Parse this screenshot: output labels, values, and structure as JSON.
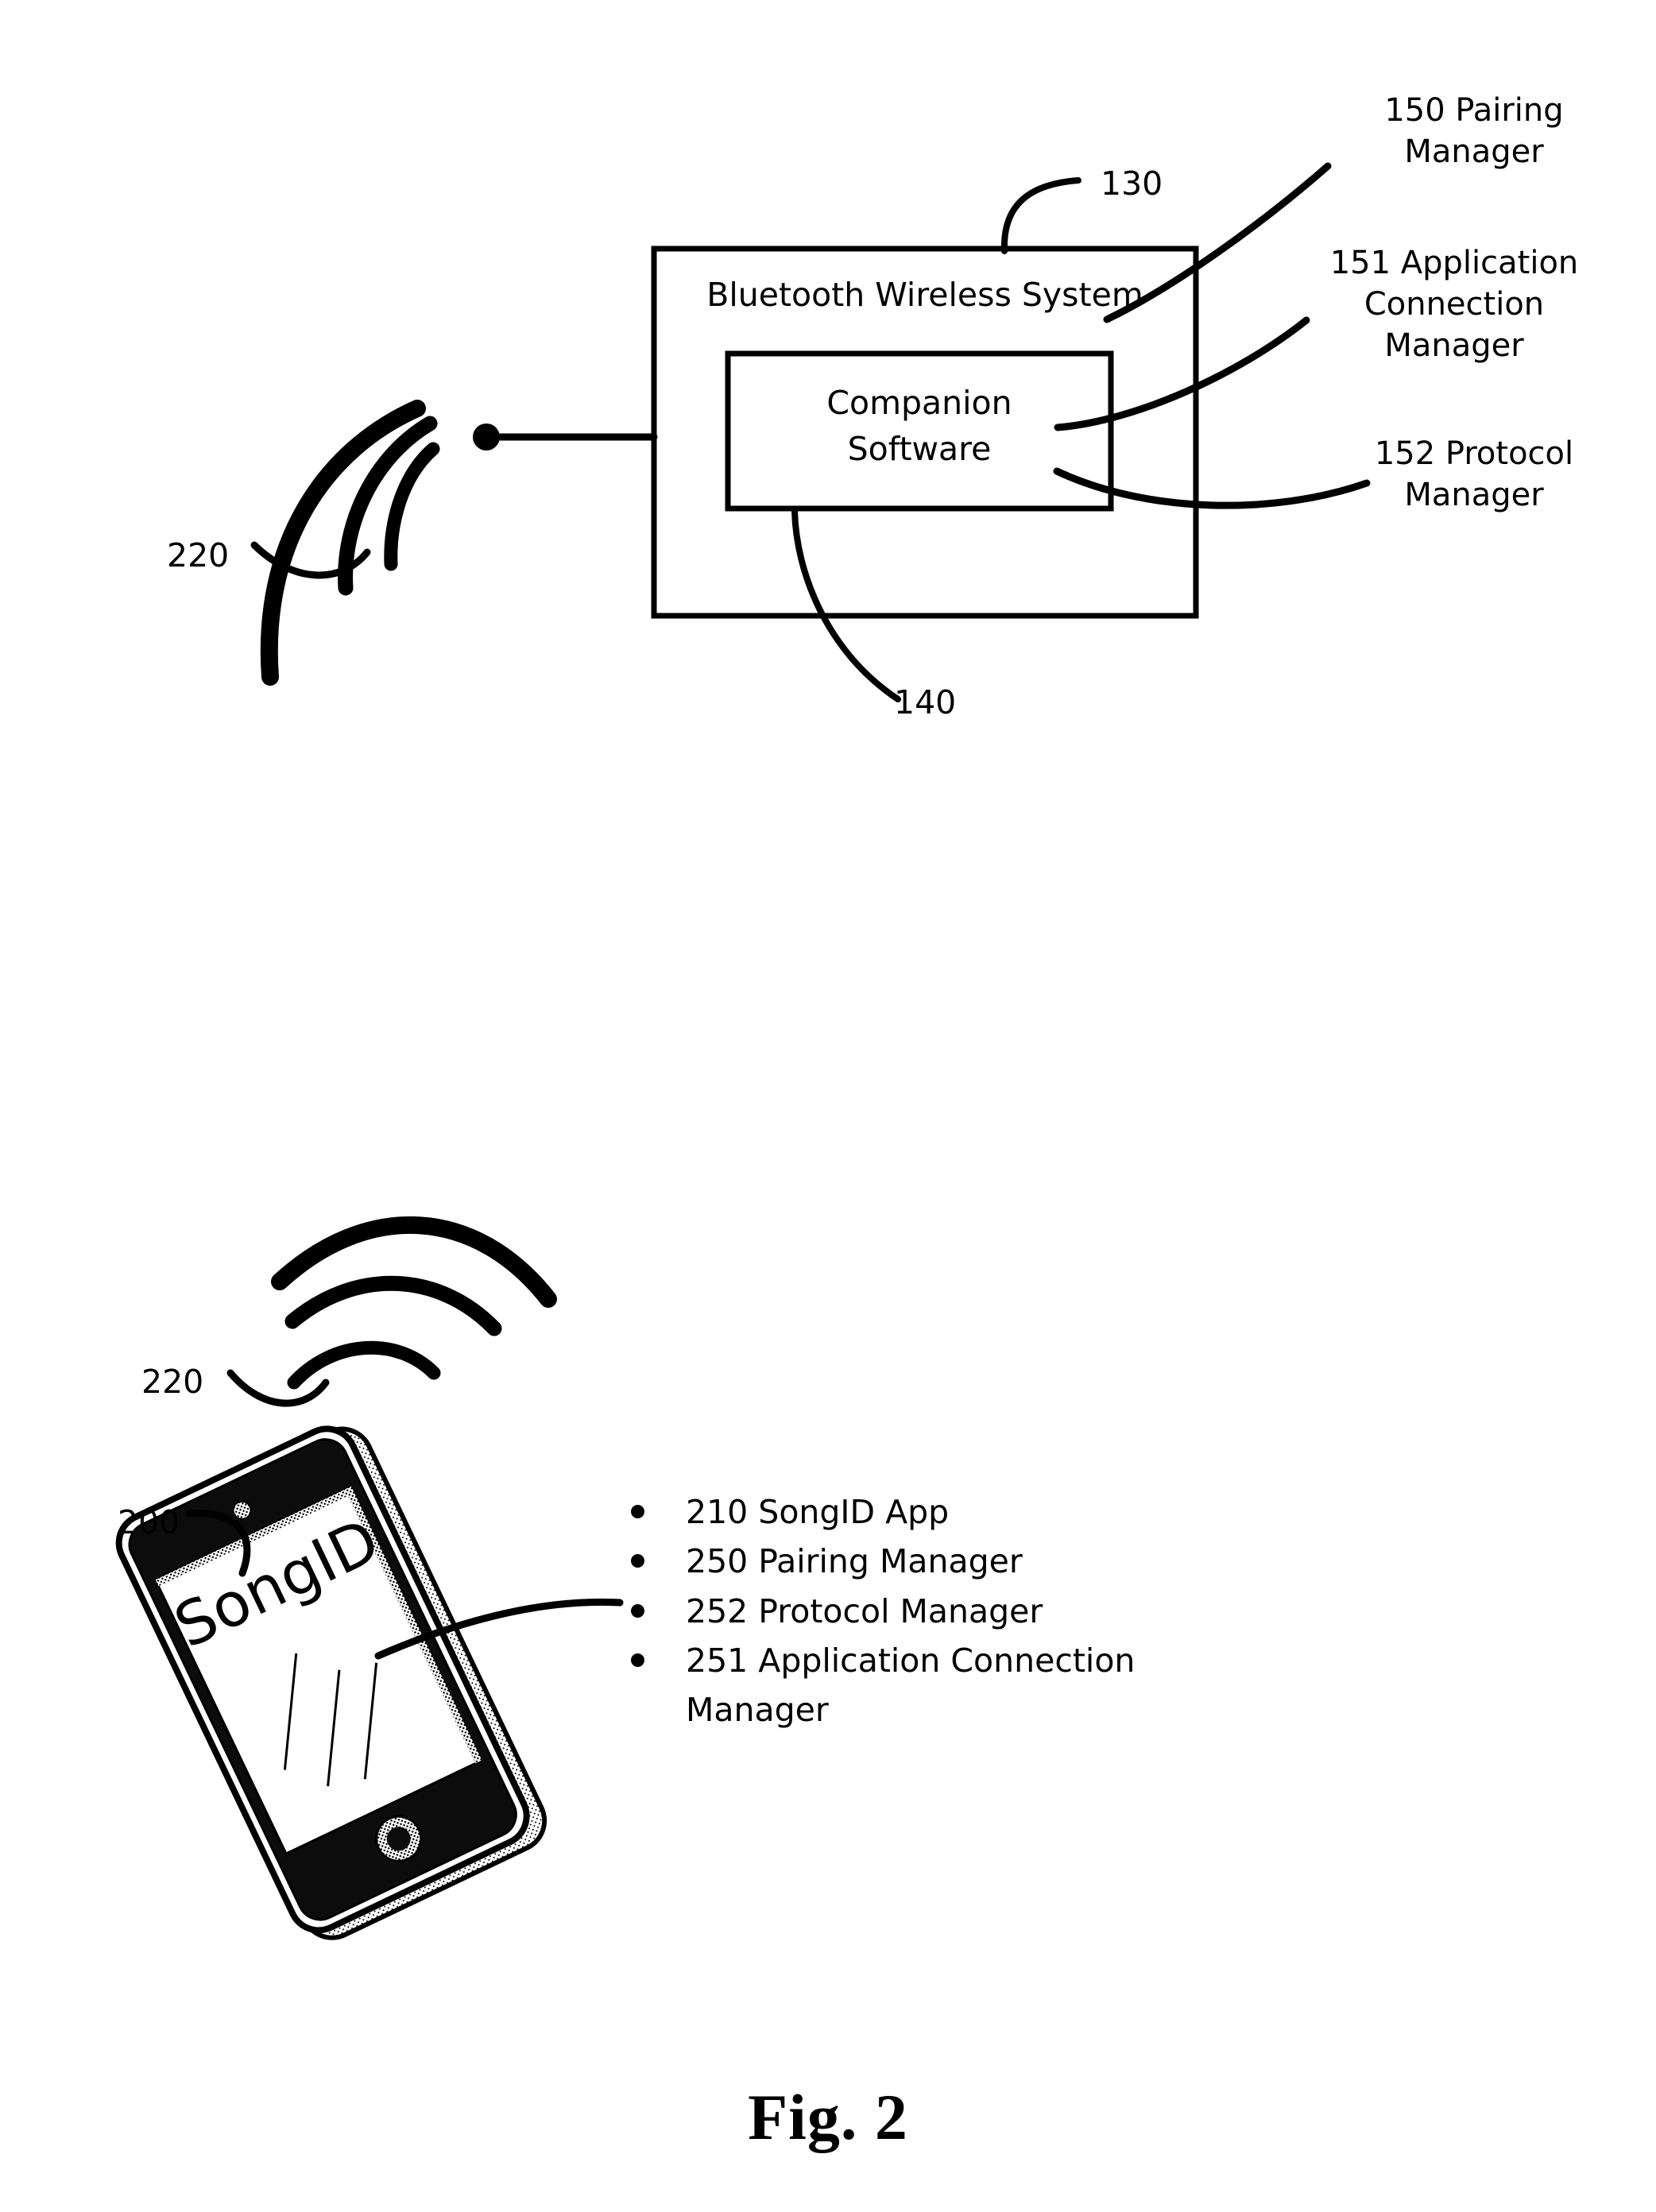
{
  "figure": {
    "caption": "Fig. 2"
  },
  "top_diagram": {
    "outer_box_label": "Bluetooth Wireless System",
    "inner_box_label": "Companion\nSoftware",
    "ref_outer_box": "130",
    "ref_inner_box": "140",
    "ref_wireless": "220",
    "callouts": [
      {
        "id": "150",
        "text": "150 Pairing\nManager"
      },
      {
        "id": "151",
        "text": "151 Application\nConnection\nManager"
      },
      {
        "id": "152",
        "text": "152 Protocol\nManager"
      }
    ]
  },
  "bottom_diagram": {
    "ref_phone": "200",
    "ref_wireless": "220",
    "phone_screen_app_name": "SongID",
    "components": [
      "210 SongID App",
      "250 Pairing Manager",
      "252 Protocol Manager",
      "251 Application Connection Manager"
    ]
  },
  "colors": {
    "ink": "#000000",
    "paper": "#ffffff",
    "bezel": "#0a0a0a",
    "screen": "#ffffff",
    "case_edge": "#b4b4b4"
  }
}
